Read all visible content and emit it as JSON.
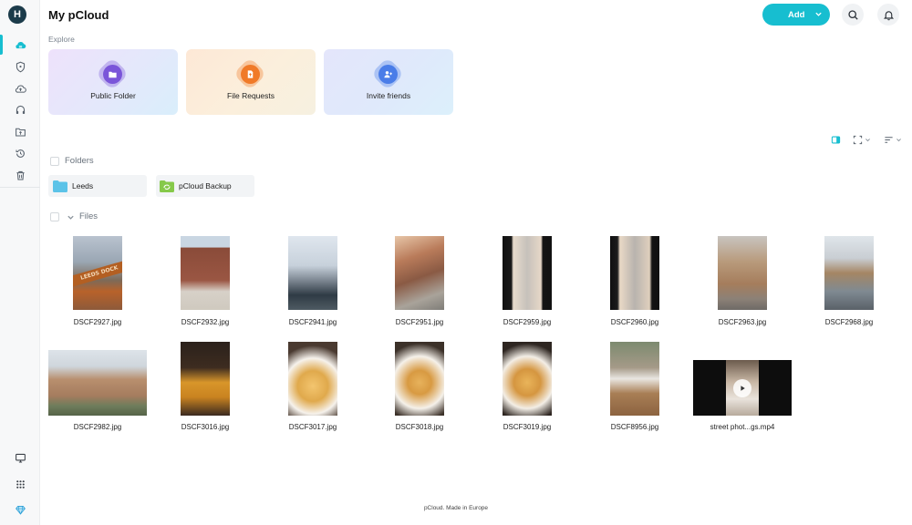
{
  "user": {
    "avatar_initial": "H"
  },
  "header": {
    "title": "My pCloud",
    "add_label": "Add"
  },
  "sidebar": {
    "items": [
      {
        "icon": "cloud-icon",
        "active": true
      },
      {
        "icon": "shield-icon"
      },
      {
        "icon": "cloud-upload-icon"
      },
      {
        "icon": "headphones-icon"
      },
      {
        "icon": "shared-folder-icon"
      },
      {
        "icon": "history-icon"
      },
      {
        "icon": "trash-icon"
      }
    ],
    "bottom_items": [
      {
        "icon": "monitor-icon"
      },
      {
        "icon": "apps-grid-icon"
      },
      {
        "icon": "diamond-icon"
      }
    ]
  },
  "explore": {
    "label": "Explore",
    "cards": [
      {
        "label": "Public Folder",
        "icon": "folder-icon",
        "color": "#7a55d9"
      },
      {
        "label": "File Requests",
        "icon": "file-request-icon",
        "color": "#f07a28"
      },
      {
        "label": "Invite friends",
        "icon": "invite-friends-icon",
        "color": "#4a7de8"
      }
    ]
  },
  "folders": {
    "label": "Folders",
    "items": [
      {
        "name": "Leeds",
        "icon": "folder-icon",
        "color": "#5cc3e8"
      },
      {
        "name": "pCloud Backup",
        "icon": "backup-folder-icon",
        "color": "#86c94a"
      }
    ]
  },
  "files": {
    "label": "Files",
    "items": [
      {
        "name": "DSCF2927.jpg"
      },
      {
        "name": "DSCF2932.jpg"
      },
      {
        "name": "DSCF2941.jpg"
      },
      {
        "name": "DSCF2951.jpg"
      },
      {
        "name": "DSCF2959.jpg"
      },
      {
        "name": "DSCF2960.jpg"
      },
      {
        "name": "DSCF2963.jpg"
      },
      {
        "name": "DSCF2968.jpg"
      },
      {
        "name": "DSCF2982.jpg"
      },
      {
        "name": "DSCF3016.jpg"
      },
      {
        "name": "DSCF3017.jpg"
      },
      {
        "name": "DSCF3018.jpg"
      },
      {
        "name": "DSCF3019.jpg"
      },
      {
        "name": "DSCF8956.jpg"
      },
      {
        "name": "street phot...gs.mp4",
        "type": "video"
      }
    ]
  },
  "footer": {
    "text": "pCloud. Made in Europe"
  },
  "colors": {
    "accent": "#17bed0"
  }
}
